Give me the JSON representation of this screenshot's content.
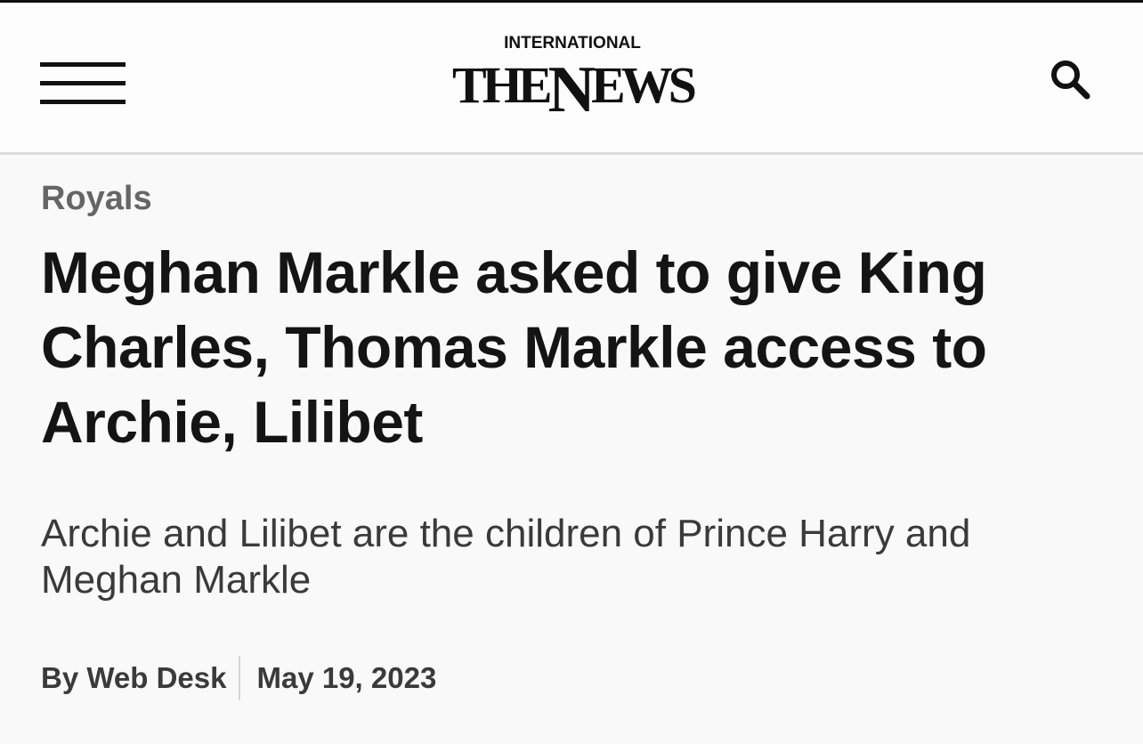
{
  "header": {
    "logo_top": "INTERNATIONAL",
    "logo_the": "THE",
    "logo_n": "N",
    "logo_ews": "EWS",
    "menu_icon": "hamburger-menu-icon",
    "search_icon": "search-icon"
  },
  "article": {
    "category": "Royals",
    "headline": "Meghan Markle asked to give King Charles, Thomas Markle access to Archie, Lilibet",
    "summary": "Archie and Lilibet are the children of Prince Harry and Meghan Markle",
    "author": "By Web Desk",
    "date": "May 19, 2023"
  },
  "colors": {
    "background": "#f9f9f9",
    "text": "#141414",
    "category": "#666666",
    "divider": "#dcdcdc"
  }
}
